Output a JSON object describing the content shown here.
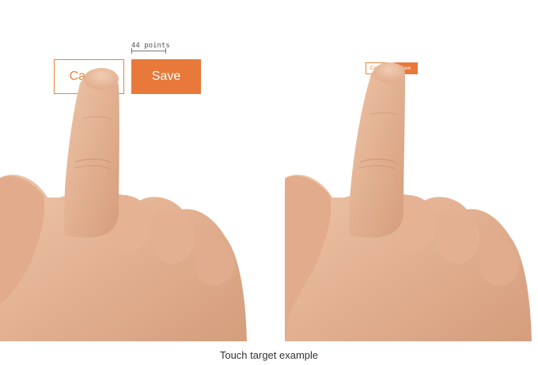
{
  "left_example": {
    "cancel_label": "Cancel",
    "save_label": "Save",
    "measure_label": "44 points"
  },
  "right_example": {
    "cancel_label": "Cancel",
    "save_label": "Save"
  },
  "caption": "Touch target example",
  "colors": {
    "accent": "#e8793a",
    "skin": "#e6b999",
    "skin_shadow": "#c98e6f"
  }
}
